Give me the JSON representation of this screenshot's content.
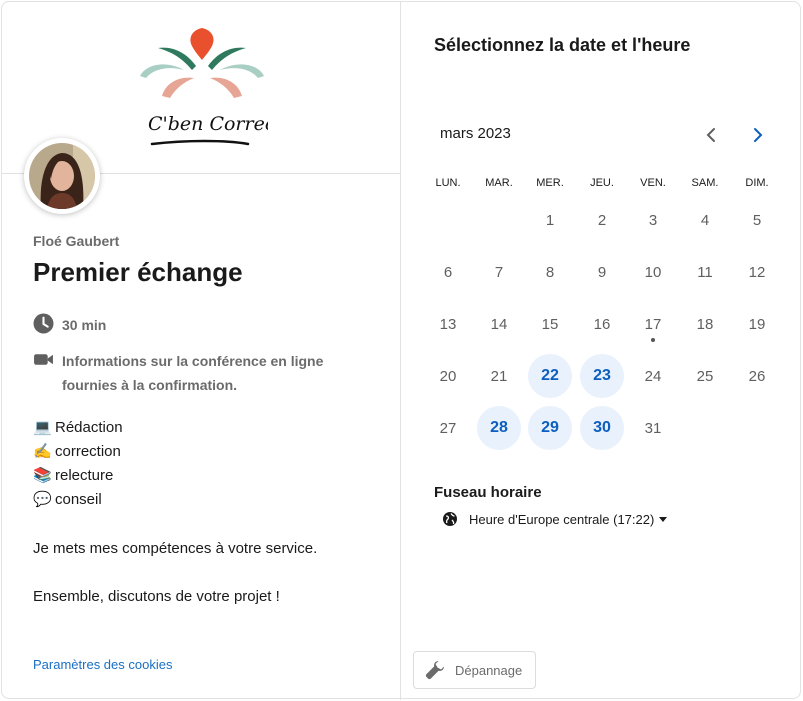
{
  "logo": {
    "text": "C'ben Correc'"
  },
  "host": {
    "name": "Floé Gaubert"
  },
  "event": {
    "title": "Premier échange",
    "duration": "30 min",
    "conference": "Informations sur la conférence en ligne fournies à la confirmation."
  },
  "description": {
    "items": [
      {
        "emoji": "💻",
        "text": "Rédaction"
      },
      {
        "emoji": "✍️",
        "text": "correction"
      },
      {
        "emoji": "📚",
        "text": "relecture"
      },
      {
        "emoji": "💬",
        "text": "conseil"
      }
    ],
    "paragraph1": "Je mets mes compétences à votre service.",
    "paragraph2": "Ensemble, discutons de votre projet !"
  },
  "footer": {
    "cookies": "Paramètres des cookies",
    "troubleshoot": "Dépannage"
  },
  "calendar": {
    "heading": "Sélectionnez la date et l'heure",
    "month": "mars 2023",
    "weekdays": [
      "LUN.",
      "MAR.",
      "MER.",
      "JEU.",
      "VEN.",
      "SAM.",
      "DIM."
    ],
    "weeks": [
      [
        "",
        "",
        "1",
        "2",
        "3",
        "4",
        "5"
      ],
      [
        "6",
        "7",
        "8",
        "9",
        "10",
        "11",
        "12"
      ],
      [
        "13",
        "14",
        "15",
        "16",
        "17",
        "18",
        "19"
      ],
      [
        "20",
        "21",
        "22",
        "23",
        "24",
        "25",
        "26"
      ],
      [
        "27",
        "28",
        "29",
        "30",
        "31",
        "",
        ""
      ]
    ],
    "available": [
      "22",
      "23",
      "28",
      "29",
      "30"
    ],
    "today": "17"
  },
  "timezone": {
    "label": "Fuseau horaire",
    "value": "Heure d'Europe centrale (17:22)"
  },
  "colors": {
    "accent": "#0c5fbf",
    "available_bg": "#e8f1fc",
    "link": "#1a6fc4"
  }
}
